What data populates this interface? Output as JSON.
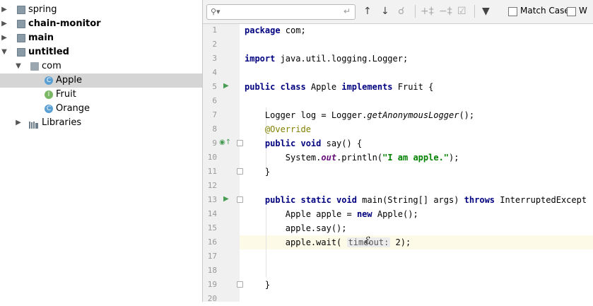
{
  "project_tree": [
    {
      "label": "spring",
      "bold": false
    },
    {
      "label": "chain-monitor",
      "bold": true
    },
    {
      "label": "main",
      "bold": true
    },
    {
      "label": "untitled",
      "bold": true
    },
    {
      "label": "com"
    },
    {
      "label": "Apple",
      "icon_letter": "C"
    },
    {
      "label": "Fruit",
      "icon_letter": "I"
    },
    {
      "label": "Orange",
      "icon_letter": "C"
    },
    {
      "label": "Libraries"
    }
  ],
  "search_bar": {
    "search_icon": "magnifier-icon",
    "input_value": "",
    "match_case_label": "Match Case",
    "match_case_mnemonic": "C",
    "words_label_partial": "W"
  },
  "editor": {
    "line_numbers": [
      "1",
      "2",
      "3",
      "4",
      "5",
      "6",
      "7",
      "8",
      "9",
      "10",
      "11",
      "12",
      "13",
      "14",
      "15",
      "16",
      "17",
      "18",
      "19",
      "20"
    ],
    "current_line": "16",
    "code": {
      "l1_kw": "package",
      "l1_rest": " com;",
      "l3_kw": "import",
      "l3_rest": " java.util.logging.Logger;",
      "l5_kw1": "public class ",
      "l5_name": "Apple ",
      "l5_kw2": "implements",
      "l5_rest": " Fruit {",
      "l7_a": "    Logger log = Logger.",
      "l7_b": "getAnonymousLogger",
      "l7_c": "();",
      "l8": "    @Override",
      "l9_kw": "    public void",
      "l9_rest": " say() {",
      "l10_a": "        System.",
      "l10_b": "out",
      "l10_c": ".println(",
      "l10_d": "\"I am apple.\"",
      "l10_e": ");",
      "l11": "    }",
      "l13_kw1": "    public static void",
      "l13_rest1": " main(String[] args) ",
      "l13_kw2": "throws",
      "l13_rest2": " InterruptedExcept",
      "l14_a": "        Apple apple = ",
      "l14_kw": "new",
      "l14_b": " Apple();",
      "l15": "        apple.say();",
      "l16_a": "        apple.wait( ",
      "l16_hint": "timeout:",
      "l16_b": " 2);",
      "l19": "    }"
    }
  },
  "colors": {
    "keyword": "#000080",
    "string": "#008000",
    "annotation": "#808000",
    "static_field": "#660e7a",
    "run_icon": "#499c54",
    "selection": "#d5d5d5"
  }
}
